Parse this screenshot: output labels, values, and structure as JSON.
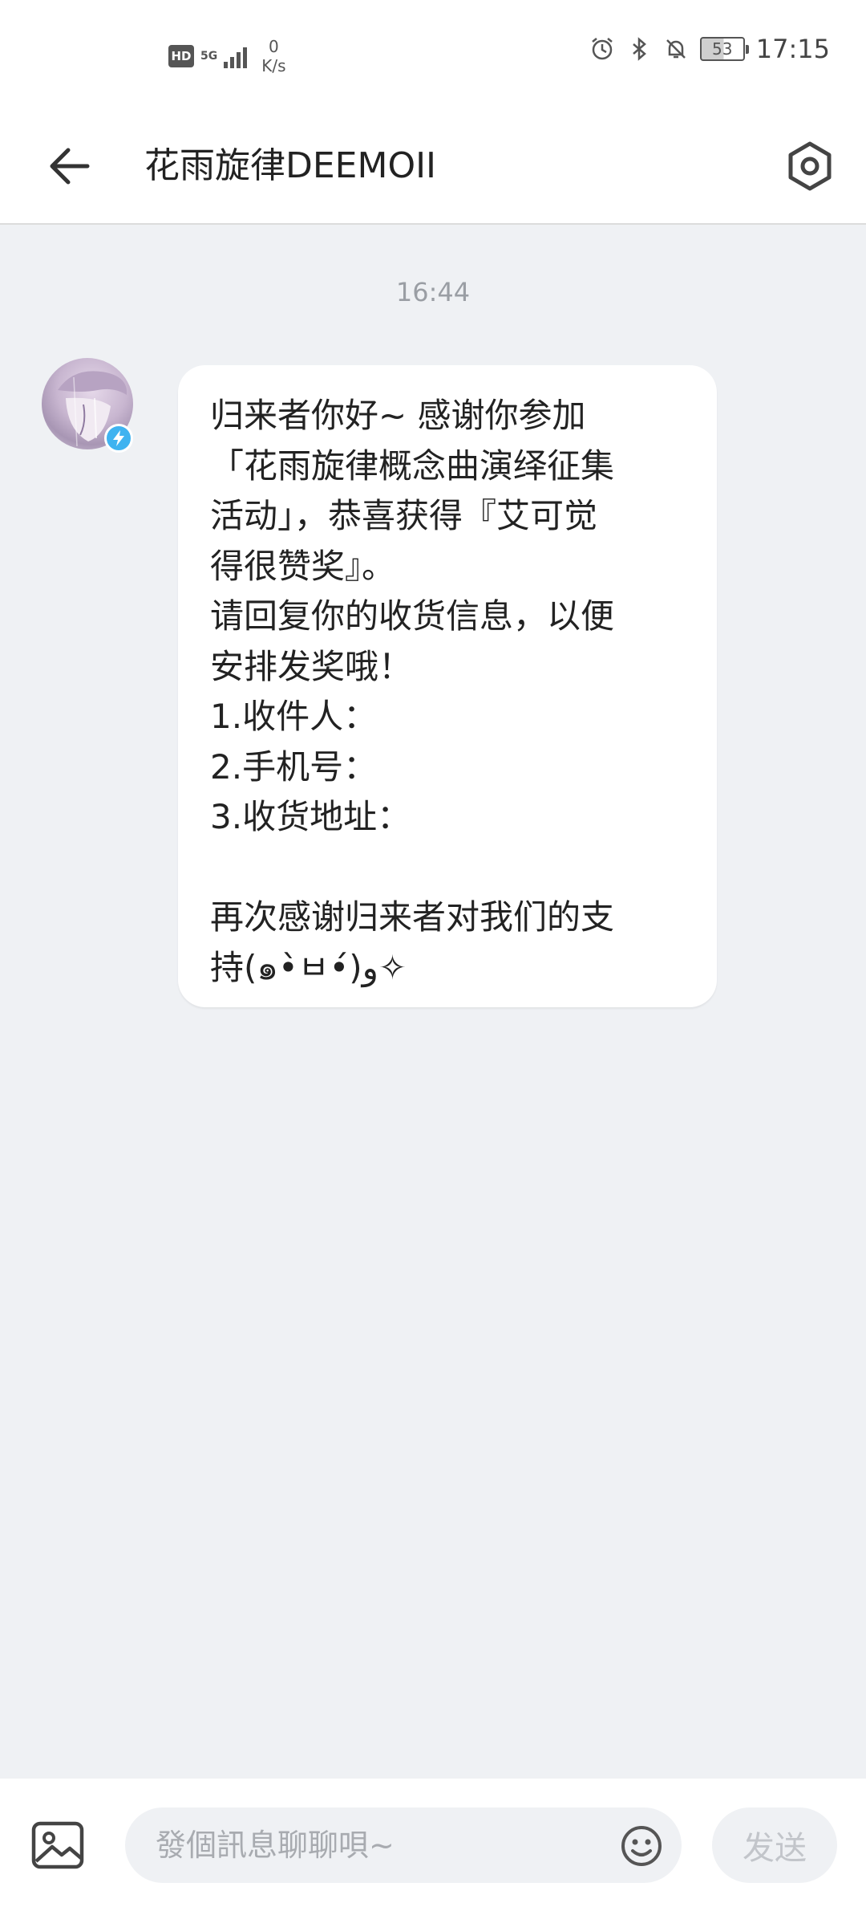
{
  "status_bar": {
    "hd_badge": "HD",
    "network_type": "5G",
    "speed_value": "0",
    "speed_unit": "K/s",
    "battery_level": "53",
    "time": "17:15"
  },
  "header": {
    "title": "花雨旋律DEEMOII",
    "back_icon": "arrow-left-icon",
    "settings_icon": "hexagon-gear-icon"
  },
  "chat": {
    "timestamp": "16:44",
    "message_lines": [
      "归来者你好~ 感谢你参加",
      "「花雨旋律概念曲演绎征集",
      "活动」，恭喜获得『艾可觉",
      "得很赞奖』。",
      "请回复你的收货信息，以便",
      "安排发奖哦！",
      "1.收件人：",
      "2.手机号：",
      "3.收货地址：",
      "",
      "再次感谢归来者对我们的支",
      "持(๑•̀ㅂ•́)و✧"
    ]
  },
  "input_bar": {
    "placeholder": "發個訊息聊聊唄~",
    "send_label": "发送",
    "image_icon": "image-icon",
    "emoji_icon": "smiley-icon"
  }
}
